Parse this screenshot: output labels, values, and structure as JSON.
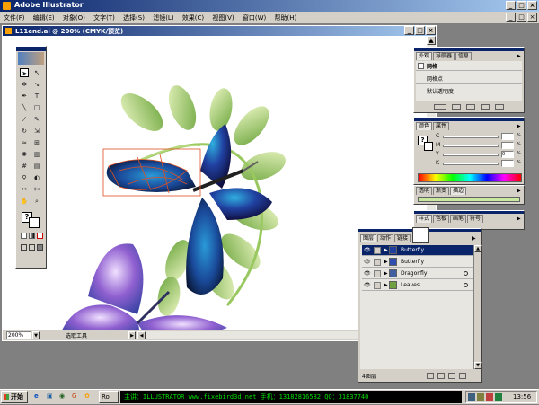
{
  "app": {
    "title": "Adobe Illustrator"
  },
  "menu": [
    "文件(F)",
    "编辑(E)",
    "对象(O)",
    "文字(T)",
    "选择(S)",
    "滤镜(L)",
    "效果(C)",
    "视图(V)",
    "窗口(W)",
    "帮助(H)"
  ],
  "document": {
    "title": "L11end.ai @ 200% (CMYK/预览)"
  },
  "status": {
    "zoom": "200%",
    "tool": "选取工具"
  },
  "appearance_panel": {
    "tabs": [
      "外观",
      "导航器",
      "信息"
    ],
    "rows": [
      "网格",
      "网格点",
      "默认透明度"
    ]
  },
  "color_panel": {
    "tabs": [
      "颜色",
      "属性"
    ],
    "channels": [
      {
        "label": "C",
        "value": ""
      },
      {
        "label": "M",
        "value": ""
      },
      {
        "label": "Y",
        "value": "0"
      },
      {
        "label": "K",
        "value": ""
      }
    ],
    "unit": "%"
  },
  "transparency_panel": {
    "tabs": [
      "透明",
      "渐变",
      "描边"
    ]
  },
  "style_panel": {
    "tabs": [
      "样式",
      "色板",
      "画笔",
      "符号"
    ]
  },
  "layers_panel": {
    "tabs": [
      "图层",
      "动作",
      "链接"
    ],
    "layers": [
      {
        "name": "Butterfly",
        "thumb": "#2040a0"
      },
      {
        "name": "Butterfly",
        "thumb": "#3050b0"
      },
      {
        "name": "Dragonfly",
        "thumb": "#4060a0"
      },
      {
        "name": "Leaves",
        "thumb": "#70a040"
      }
    ],
    "count": "4图层"
  },
  "taskbar": {
    "start": "开始",
    "item": "Ro",
    "ticker": "主讲：ILLUSTRATOR  www.fixebird3d.net  手机：13182816582  QQ：31837740",
    "clock": "13:56"
  },
  "colors": {
    "accent": "#0a246a",
    "chrome": "#d4d0c8",
    "desktop": "#808080"
  }
}
